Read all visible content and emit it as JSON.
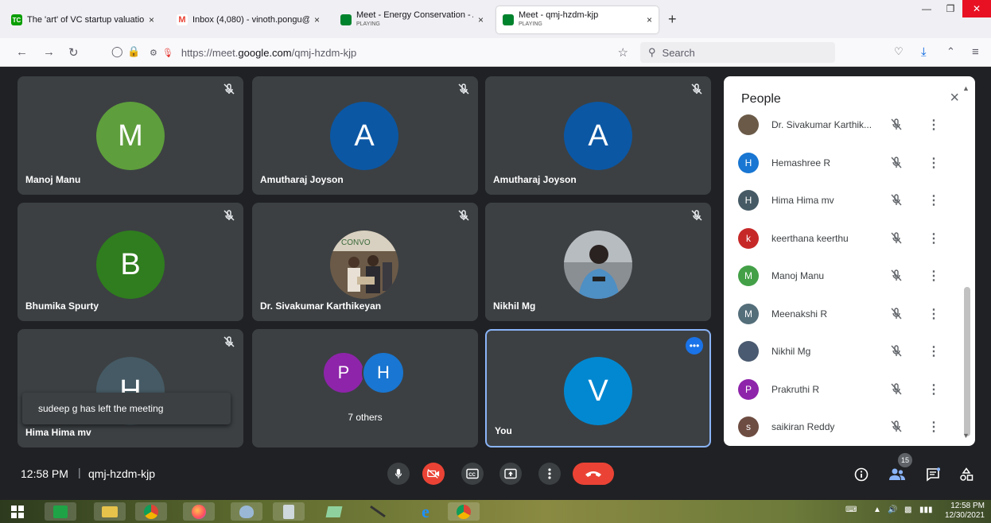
{
  "browser": {
    "tabs": [
      {
        "title": "The 'art' of VC startup valuation",
        "favicon": "TC",
        "favicon_color": "#0a9e01",
        "close": "×"
      },
      {
        "title": "Inbox (4,080) - vinoth.pongu@g",
        "favicon": "M",
        "favicon_color": "#ea4335",
        "close": "×"
      },
      {
        "title": "Meet - Energy Conservation - A",
        "sub": "PLAYING",
        "favicon_color": "#00832d",
        "close": "×"
      },
      {
        "title": "Meet - qmj-hzdm-kjp",
        "sub": "PLAYING",
        "favicon_color": "#00832d",
        "close": "×"
      }
    ],
    "new_tab": "+",
    "url_prefix": "https://meet.",
    "url_domain": "google.com",
    "url_path": "/qmj-hzdm-kjp",
    "search_placeholder": "Search"
  },
  "tiles": [
    {
      "name": "Manoj Manu",
      "initial": "M",
      "color": "#5e9e3c"
    },
    {
      "name": "Amutharaj Joyson",
      "initial": "A",
      "color": "#0b57a4"
    },
    {
      "name": "Amutharaj Joyson",
      "initial": "A",
      "color": "#0b57a4"
    },
    {
      "name": "Bhumika Spurty",
      "initial": "B",
      "color": "#2f7d1e"
    },
    {
      "name": "Dr. Sivakumar Karthikeyan",
      "initial": "",
      "color": "#6b5a48"
    },
    {
      "name": "Nikhil Mg",
      "initial": "",
      "color": "#4a5a70"
    },
    {
      "name": "Hima Hima mv",
      "initial": "H",
      "color": "#455a64"
    },
    {
      "name": "",
      "initial": "",
      "color": ""
    },
    {
      "name": "You",
      "initial": "V",
      "color": "#0288d1"
    }
  ],
  "others": {
    "avatars": [
      {
        "initial": "P",
        "color": "#8e24aa"
      },
      {
        "initial": "H",
        "color": "#1976d2"
      }
    ],
    "label": "7 others"
  },
  "toast": "sudeep g has left the meeting",
  "people_panel": {
    "title": "People",
    "close": "×",
    "participants": [
      {
        "name": "Dr. Sivakumar Karthik...",
        "initial": "",
        "color": "#6b5a48"
      },
      {
        "name": "Hemashree R",
        "initial": "H",
        "color": "#1976d2"
      },
      {
        "name": "Hima Hima mv",
        "initial": "H",
        "color": "#455a64"
      },
      {
        "name": "keerthana keerthu",
        "initial": "k",
        "color": "#c62828"
      },
      {
        "name": "Manoj Manu",
        "initial": "M",
        "color": "#43a047"
      },
      {
        "name": "Meenakshi R",
        "initial": "M",
        "color": "#546e7a"
      },
      {
        "name": "Nikhil Mg",
        "initial": "",
        "color": "#4a5a70"
      },
      {
        "name": "Prakruthi R",
        "initial": "P",
        "color": "#8e24aa"
      },
      {
        "name": "saikiran Reddy",
        "initial": "s",
        "color": "#6d4c41"
      }
    ]
  },
  "meeting": {
    "time": "12:58 PM",
    "separator": "|",
    "code": "qmj-hzdm-kjp",
    "participant_count": "15"
  },
  "taskbar": {
    "clock_time": "12:58 PM",
    "clock_date": "12/30/2021"
  },
  "colors": {
    "accent": "#8ab4f8",
    "danger": "#ea4335",
    "tile_bg": "#3c4043",
    "stage_bg": "#202124"
  }
}
